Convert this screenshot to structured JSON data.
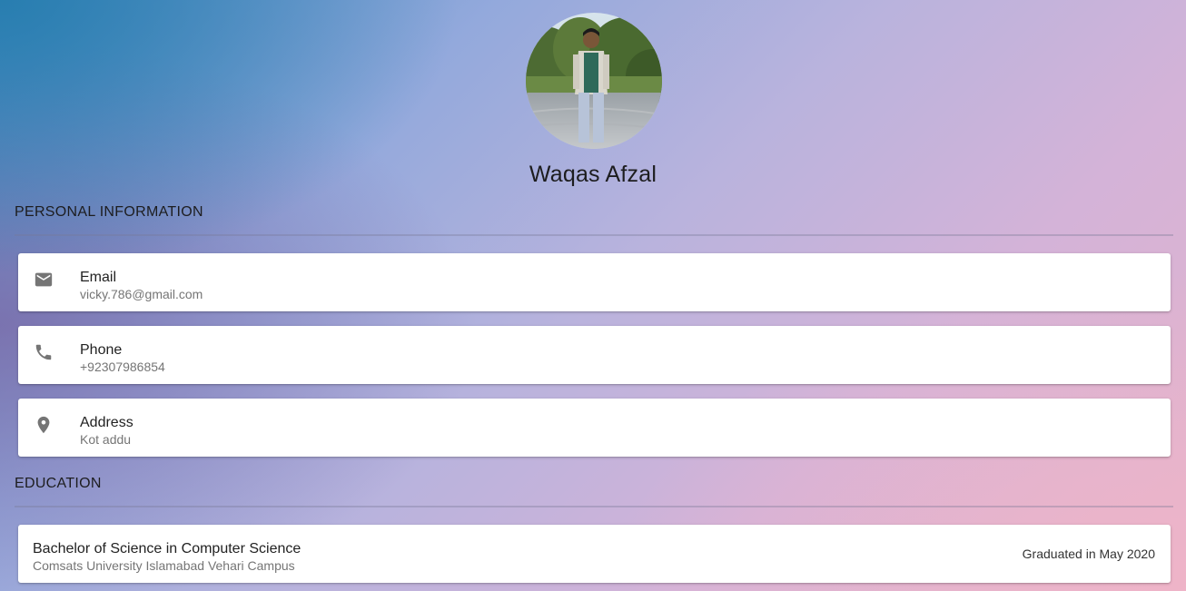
{
  "profile": {
    "name": "Waqas Afzal",
    "avatar_icon": "profile-photo"
  },
  "personal_information": {
    "title": "PERSONAL INFORMATION",
    "items": [
      {
        "label": "Email",
        "value": "vicky.786@gmail.com",
        "icon": "email-icon"
      },
      {
        "label": "Phone",
        "value": "+92307986854",
        "icon": "phone-icon"
      },
      {
        "label": "Address",
        "value": "Kot addu",
        "icon": "location-pin-icon"
      }
    ]
  },
  "education": {
    "title": "EDUCATION",
    "items": [
      {
        "degree": "Bachelor of Science in Computer Science",
        "school": "Comsats University Islamabad Vehari Campus",
        "date": "Graduated in May 2020"
      }
    ]
  },
  "colors": {
    "icon": "#757575",
    "card": "#ffffff",
    "text": "#1d1d1f"
  }
}
